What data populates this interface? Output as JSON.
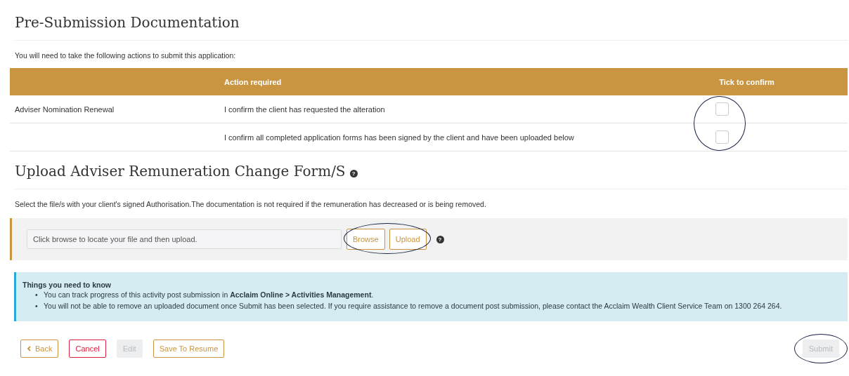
{
  "title": "Pre-Submission Documentation",
  "intro": "You will need to take the following actions to submit this application:",
  "table": {
    "columns": [
      "",
      "Action required",
      "Tick to confirm"
    ],
    "rows": [
      {
        "item": "Adviser Nomination Renewal",
        "action": "I confirm the client has requested the alteration",
        "checked": false
      },
      {
        "item": "",
        "action": "I confirm all completed application forms has been signed by the client and have been uploaded below",
        "checked": false
      }
    ],
    "checkboxes_circled": true
  },
  "upload": {
    "title": "Upload Adviser Remuneration Change Form/S",
    "help_icon_glyph": "?",
    "instructions": "Select the file/s with your client's signed Authorisation.The documentation is not required if the remuneration has decreased or is being removed.",
    "file_field": {
      "placeholder": "Click browse to locate your file and then upload."
    },
    "buttons": [
      "Browse",
      "Upload"
    ],
    "buttons_circled": true,
    "help_glyph": "?"
  },
  "notice": {
    "title": "Things you need to know",
    "marker": "•",
    "items": [
      "You can track progress of this activity post submission in **Acclaim Online > Activities Management**.",
      "You will not be able to remove an uploaded document once Submit has been selected. If you require assistance to remove a document post submission, please contact the Acclaim Wealth Client Service Team on 1300 264 264."
    ]
  },
  "actions": [
    {
      "label": "Back",
      "kind": "back",
      "disabled": false,
      "circled": false
    },
    {
      "label": "Cancel",
      "kind": "danger",
      "disabled": false,
      "circled": false
    },
    {
      "label": "Edit",
      "kind": "plain",
      "disabled": true,
      "circled": false
    },
    {
      "label": "Save To Resume",
      "kind": "plain",
      "disabled": false,
      "circled": false
    },
    {
      "label": "Submit",
      "kind": "submit",
      "disabled": true,
      "circled": true
    }
  ]
}
